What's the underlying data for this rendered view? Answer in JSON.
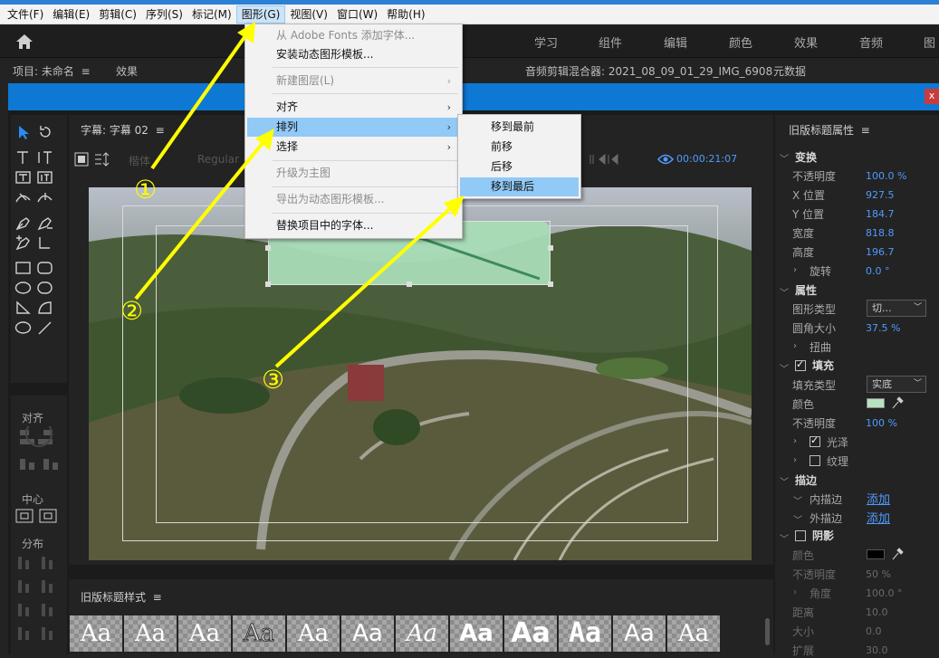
{
  "menubar": {
    "items": [
      "文件(F)",
      "编辑(E)",
      "剪辑(C)",
      "序列(S)",
      "标记(M)",
      "图形(G)",
      "视图(V)",
      "窗口(W)",
      "帮助(H)"
    ]
  },
  "workspaces": [
    "学习",
    "组件",
    "编辑",
    "颜色",
    "效果",
    "音频",
    "图"
  ],
  "panel_headers": {
    "project": "项目: 未命名",
    "effects": "效果",
    "mixer": "音频剪辑混合器: 2021_08_09_01_29_IMG_6908",
    "metadata": "元数据"
  },
  "graphics_menu": {
    "items": [
      {
        "label": "从 Adobe Fonts 添加字体...",
        "disabled": true,
        "sub": false
      },
      {
        "label": "安装动态图形模板...",
        "disabled": false,
        "sub": false
      },
      {
        "label": "新建图层(L)",
        "disabled": true,
        "sub": true
      },
      {
        "label": "对齐",
        "disabled": false,
        "sub": true
      },
      {
        "label": "排列",
        "disabled": false,
        "sub": true,
        "highlight": true
      },
      {
        "label": "选择",
        "disabled": false,
        "sub": true
      },
      {
        "label": "升级为主图",
        "disabled": true,
        "sub": false
      },
      {
        "label": "导出为动态图形模板...",
        "disabled": true,
        "sub": false
      },
      {
        "label": "替换项目中的字体...",
        "disabled": false,
        "sub": false
      }
    ]
  },
  "arrange_submenu": {
    "items": [
      "移到最前",
      "前移",
      "后移",
      "移到最后"
    ],
    "highlight_index": 3
  },
  "title_panel": {
    "title": "字幕: 字幕 02",
    "font_family": "楷体",
    "font_style": "Regular",
    "timecode": "00:00:21:07"
  },
  "left_panel": {
    "align": "对齐",
    "center": "中心",
    "distribute": "分布"
  },
  "styles_panel": {
    "title": "旧版标题样式",
    "swatches": [
      "Aa",
      "Aa",
      "Aa",
      "Aa",
      "Aa",
      "Aa",
      "Aa",
      "Aa",
      "Aa",
      "Aa",
      "Aa",
      "Aa"
    ]
  },
  "properties": {
    "title": "旧版标题属性",
    "transform": {
      "label": "变换",
      "rows": [
        {
          "label": "不透明度",
          "value": "100.0 %"
        },
        {
          "label": "X 位置",
          "value": "927.5"
        },
        {
          "label": "Y 位置",
          "value": "184.7"
        },
        {
          "label": "宽度",
          "value": "818.8"
        },
        {
          "label": "高度",
          "value": "196.7"
        }
      ],
      "rotation": {
        "label": "旋转",
        "value": "0.0 °"
      }
    },
    "attributes": {
      "label": "属性",
      "shape_type_label": "图形类型",
      "shape_type_value": "切...",
      "corner_label": "圆角大小",
      "corner_value": "37.5 %",
      "distort_label": "扭曲"
    },
    "fill": {
      "label": "填充",
      "type_label": "填充类型",
      "type_value": "实底",
      "color_label": "颜色",
      "color": "#b5e3c0",
      "opacity_label": "不透明度",
      "opacity_value": "100 %",
      "sheen_label": "光泽",
      "texture_label": "纹理"
    },
    "stroke": {
      "label": "描边",
      "inner_label": "内描边",
      "inner_action": "添加",
      "outer_label": "外描边",
      "outer_action": "添加"
    },
    "shadow": {
      "label": "阴影",
      "color_label": "颜色",
      "color": "#000000",
      "opacity_label": "不透明度",
      "opacity_value": "50 %",
      "angle_label": "角度",
      "angle_value": "100.0 °",
      "distance_label": "距离",
      "distance_value": "10.0",
      "size_label": "大小",
      "size_value": "0.0",
      "spread_label": "扩展",
      "spread_value": "30.0"
    }
  },
  "annotations": {
    "labels": [
      "①",
      "②",
      "③"
    ],
    "color": "#ffff00"
  },
  "colors": {
    "accent_blue": "#0e78d5",
    "value_blue": "#4f9bff",
    "shape_fill": "#a8dcb6"
  }
}
